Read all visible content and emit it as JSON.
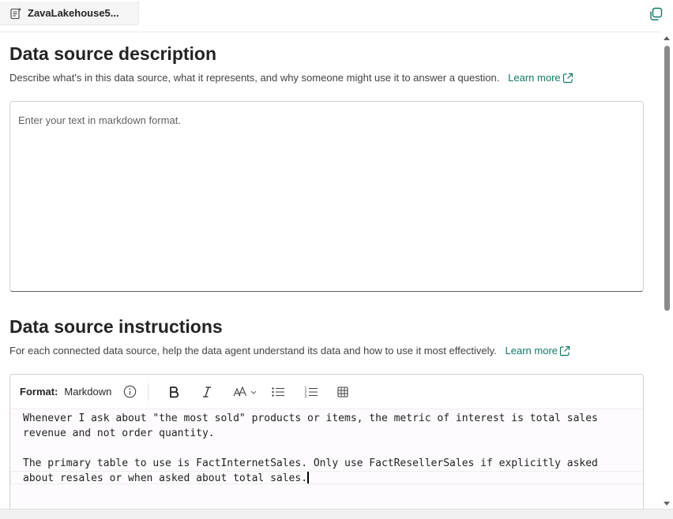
{
  "tab": {
    "label": "ZavaLakehouse5...",
    "icon": "notebook-sparkle-icon"
  },
  "header": {
    "copy_icon": "copy-icon"
  },
  "description_section": {
    "title": "Data source description",
    "text": "Describe what's in this data source, what it represents, and why someone might use it to answer a question.",
    "learn_more": "Learn more",
    "placeholder": "Enter your text in markdown format."
  },
  "instructions_section": {
    "title": "Data source instructions",
    "text": "For each connected data source, help the data agent understand its data and how to use it most effectively.",
    "learn_more": "Learn more",
    "format_label": "Format:",
    "format_value": "Markdown",
    "toolbar_icons": [
      "info-icon",
      "bold-icon",
      "italic-icon",
      "font-size-icon",
      "bullet-list-icon",
      "numbered-list-icon",
      "table-icon"
    ],
    "lines": [
      "Whenever I ask about \"the most sold\" products or items, the metric of interest is total sales",
      "revenue and not order quantity.",
      "",
      "The primary table to use is FactInternetSales. Only use FactResellerSales if explicitly asked",
      "about resales or when asked about total sales."
    ]
  },
  "colors": {
    "link": "#117865",
    "text": "#242424",
    "border": "#d1d1d1"
  }
}
